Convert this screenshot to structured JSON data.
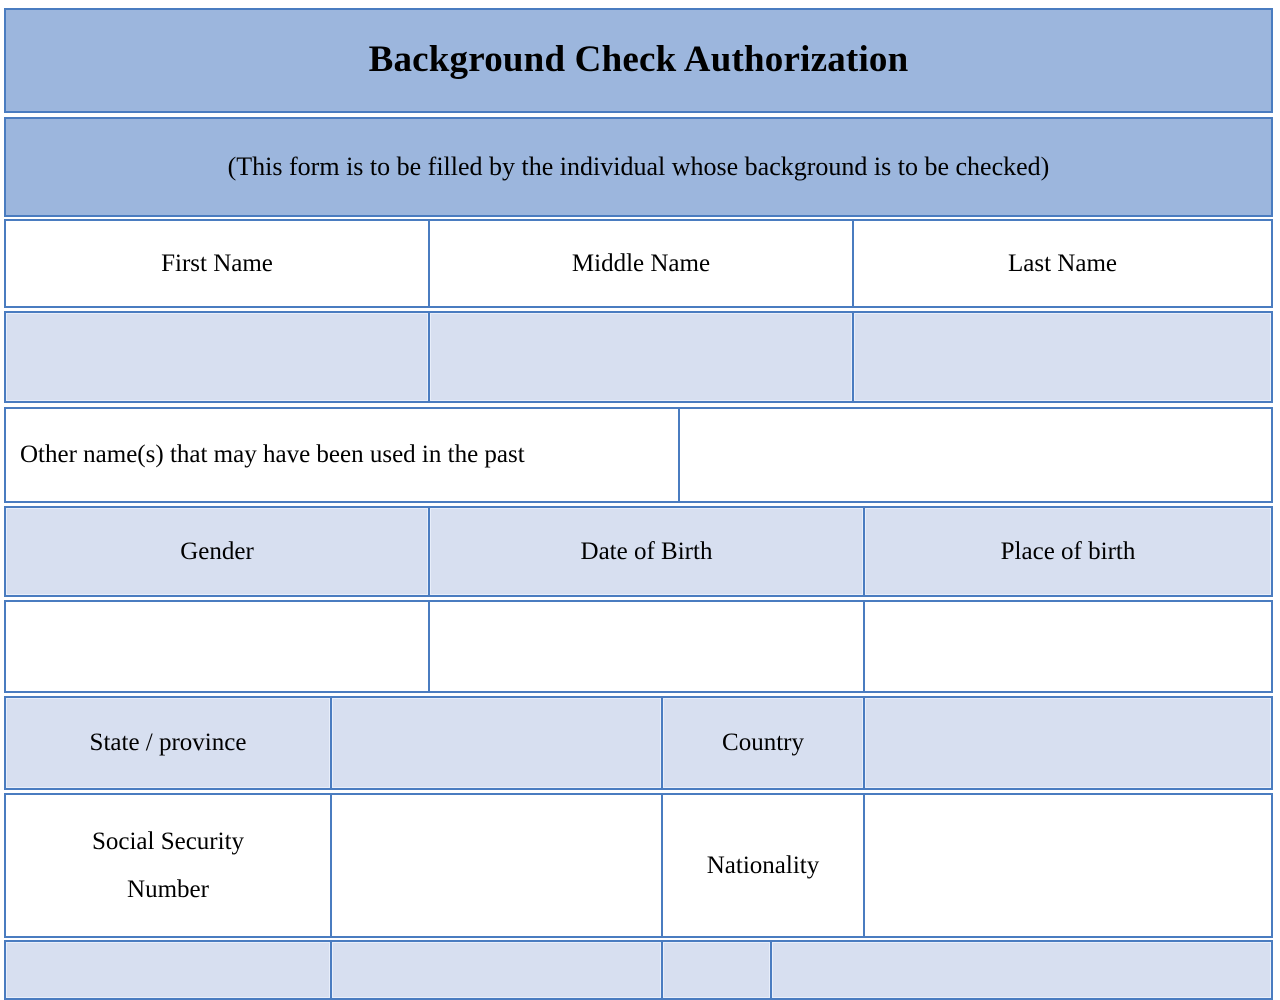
{
  "document": {
    "title": "Background Check Authorization",
    "subtitle": "(This form is to be filled by the individual whose background is to be checked)"
  },
  "colors": {
    "header_fill": "#9cb6dd",
    "field_fill": "#d7dff0",
    "empty_fill": "#ffffff",
    "border": "#4a7cc0",
    "text": "#000000"
  },
  "rows": {
    "name_labels": {
      "first_name": "First Name",
      "middle_name": "Middle Name",
      "last_name": "Last Name"
    },
    "name_values": {
      "first_name": "",
      "middle_name": "",
      "last_name": ""
    },
    "other_names": {
      "label": "Other name(s) that may have been used in the past",
      "value": ""
    },
    "birth_labels": {
      "gender": "Gender",
      "date_of_birth": "Date of Birth",
      "place_of_birth": "Place of birth"
    },
    "birth_values": {
      "gender": "",
      "date_of_birth": "",
      "place_of_birth": ""
    },
    "location": {
      "state_label": "State / province",
      "state_value": "",
      "country_label": "Country",
      "country_value": ""
    },
    "identity": {
      "ssn_label_line1": "Social Security",
      "ssn_label_line2": "Number",
      "ssn_value": "",
      "nationality_label": "Nationality",
      "nationality_value": ""
    },
    "next_row": {
      "cell_1": "",
      "cell_2": "",
      "cell_3": "",
      "cell_4": ""
    }
  }
}
